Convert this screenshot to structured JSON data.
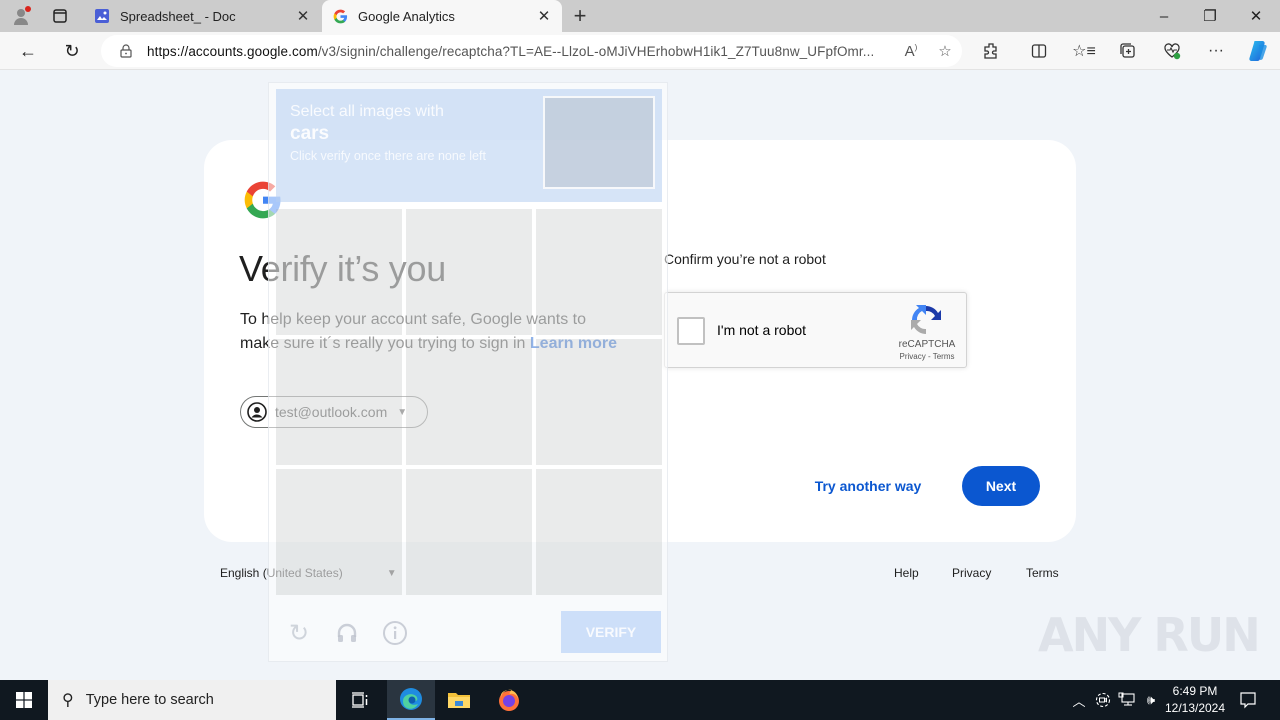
{
  "browser": {
    "tabs": [
      {
        "title": "Spreadsheet_ - Doc",
        "favicon": "image-doc-icon",
        "active": false
      },
      {
        "title": "Google Analytics",
        "favicon": "google-g-icon",
        "active": true
      }
    ],
    "new_tab_glyph": "+",
    "url_domain": "https://accounts.google.com",
    "url_path": "/v3/signin/challenge/recaptcha?TL=AE--LlzoL-oMJiVHErhobwH1ik1_Z7Tuu8nw_UFpfOmr...",
    "window_controls": {
      "minimize": "–",
      "restore": "❐",
      "close": "✕"
    }
  },
  "page": {
    "title": "Verify it’s you",
    "description": "To help keep your account safe, Google wants to make sure it´s really you trying to sign in ",
    "learn_more": "Learn more",
    "account_email": "test@outlook.com",
    "confirm_label": "Confirm you’re not a robot",
    "recaptcha": {
      "checkbox_label": "I'm not a robot",
      "brand": "reCAPTCHA",
      "links": "Privacy - Terms",
      "checked": false
    },
    "try_another_way": "Try another way",
    "next": "Next",
    "language": "English (United States)",
    "footer_links": [
      "Help",
      "Privacy",
      "Terms"
    ]
  },
  "challenge": {
    "line1": "Select all images with",
    "target": "cars",
    "line3": "Click verify once there are none left",
    "verify": "VERIFY",
    "tiles": 9
  },
  "watermark": "ANY RUN",
  "taskbar": {
    "search_placeholder": "Type here to search",
    "time": "6:49 PM",
    "date": "12/13/2024"
  },
  "colors": {
    "accent": "#0b57d0",
    "page_bg": "#f0f4f9",
    "card_bg": "#ffffff"
  }
}
